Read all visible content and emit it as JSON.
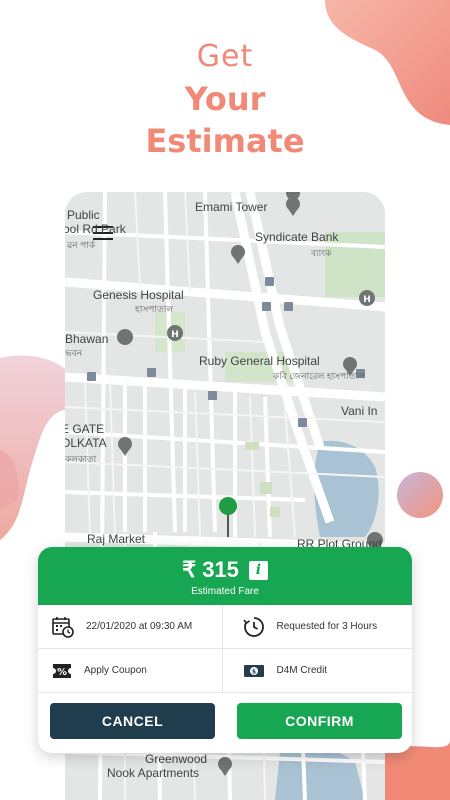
{
  "headline": {
    "line1": "Get",
    "line2": "Your",
    "line3": "Estimate"
  },
  "map": {
    "labels": {
      "public_school": "Public",
      "public_school_2": "ool Rd Park",
      "public_school_sub": "ৱন পার্ক",
      "emami_tower": "Emami Tower",
      "syndicate_bank": "Syndicate Bank",
      "syndicate_sub": "ব্যাংক",
      "genesis": "Genesis Hospital",
      "genesis_sub": "হাসপাতাল",
      "bhawan": "Bhawan",
      "bhawan_sub": "ভবন",
      "ruby": "Ruby General Hospital",
      "ruby_sub": "কবি জেনারেল হাসপাতাল",
      "vani": "Vani In",
      "gate": "E GATE",
      "kolkata": "OLKATA",
      "kolkata_sub": "কলকাতা",
      "raj_market": "Raj Market",
      "rr_plot": "RR Plot Ground",
      "greenwood": "Greenwood",
      "nook": "Nook Apartments"
    }
  },
  "fare": {
    "amount": "₹ 315",
    "info_glyph": "i",
    "label": "Estimated Fare"
  },
  "details": {
    "datetime": "22/01/2020 at 09:30 AM",
    "duration": "Requested for 3 Hours",
    "coupon": "Apply Coupon",
    "credit": "D4M Credit"
  },
  "actions": {
    "cancel": "CANCEL",
    "confirm": "CONFIRM"
  },
  "colors": {
    "accent": "#f08a77",
    "green": "#17a652",
    "navy": "#203d4d"
  }
}
